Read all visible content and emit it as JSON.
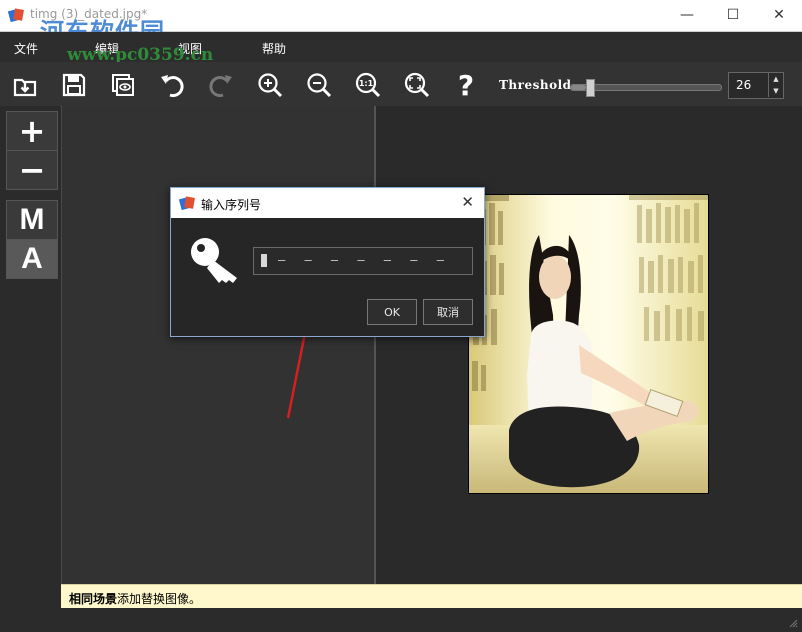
{
  "window": {
    "title": "timg (3)_dated.jpg*",
    "watermark_name": "河东软件园",
    "watermark_url": "www.pc0359.cn",
    "minimize": "—",
    "maximize": "☐",
    "close": "✕"
  },
  "menu": {
    "items": [
      {
        "label": "文件"
      },
      {
        "label": "编辑"
      },
      {
        "label": "视图"
      },
      {
        "label": "帮助"
      }
    ]
  },
  "toolbar": {
    "buttons": [
      "open-icon",
      "save-icon",
      "preview-icon",
      "undo-icon",
      "redo-icon",
      "zoom-in-icon",
      "zoom-out-icon",
      "zoom-actual-icon",
      "fit-window-icon",
      "help-icon"
    ],
    "zoom_actual_label": "1:1",
    "help_label": "?",
    "threshold_label": "Threshold",
    "threshold_value": "26",
    "threshold_fraction": 0.1
  },
  "left_tools": {
    "add_label": "+",
    "remove_label": "−",
    "manual_label": "M",
    "auto_label": "A"
  },
  "dialog": {
    "title": "输入序列号",
    "serial_placeholder": "– – – – – – –",
    "ok_label": "OK",
    "cancel_label": "取消"
  },
  "status": {
    "bold": "相同场景",
    "text": "添加替换图像。"
  },
  "colors": {
    "accent_arrow": "#d42020",
    "status_bg": "#fff8cc",
    "dialog_border": "#8aa7d0"
  }
}
